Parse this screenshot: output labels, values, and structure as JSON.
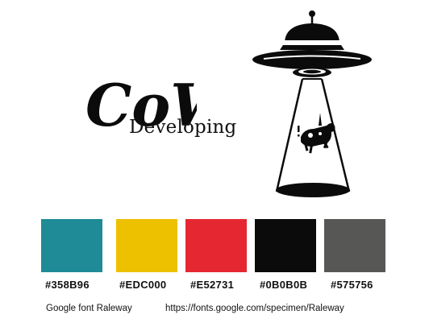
{
  "brand": {
    "script_text": "CoW",
    "subtitle": "Developing"
  },
  "palette": [
    {
      "hex_label": "#358B96",
      "color": "#1E8B96"
    },
    {
      "hex_label": "#EDC000",
      "color": "#EDC000"
    },
    {
      "hex_label": "#E52731",
      "color": "#E52731"
    },
    {
      "hex_label": "#0B0B0B",
      "color": "#0B0B0B"
    },
    {
      "hex_label": "#575756",
      "color": "#575756"
    }
  ],
  "footer": {
    "font_note": "Google font Raleway",
    "font_url": "https://fonts.google.com/specimen/Raleway"
  },
  "icons": {
    "illustration": "ufo-abducting-cow-icon"
  }
}
